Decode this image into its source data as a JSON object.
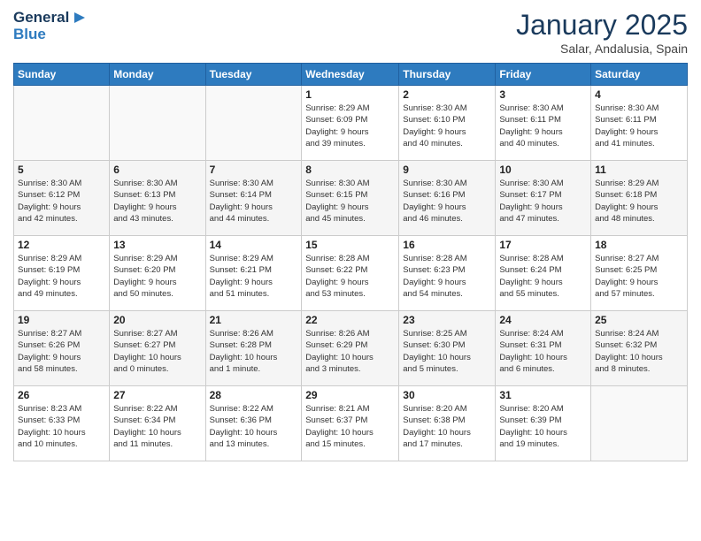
{
  "header": {
    "logo_line1": "General",
    "logo_line2": "Blue",
    "month": "January 2025",
    "location": "Salar, Andalusia, Spain"
  },
  "weekdays": [
    "Sunday",
    "Monday",
    "Tuesday",
    "Wednesday",
    "Thursday",
    "Friday",
    "Saturday"
  ],
  "weeks": [
    [
      {
        "day": "",
        "info": ""
      },
      {
        "day": "",
        "info": ""
      },
      {
        "day": "",
        "info": ""
      },
      {
        "day": "1",
        "info": "Sunrise: 8:29 AM\nSunset: 6:09 PM\nDaylight: 9 hours\nand 39 minutes."
      },
      {
        "day": "2",
        "info": "Sunrise: 8:30 AM\nSunset: 6:10 PM\nDaylight: 9 hours\nand 40 minutes."
      },
      {
        "day": "3",
        "info": "Sunrise: 8:30 AM\nSunset: 6:11 PM\nDaylight: 9 hours\nand 40 minutes."
      },
      {
        "day": "4",
        "info": "Sunrise: 8:30 AM\nSunset: 6:11 PM\nDaylight: 9 hours\nand 41 minutes."
      }
    ],
    [
      {
        "day": "5",
        "info": "Sunrise: 8:30 AM\nSunset: 6:12 PM\nDaylight: 9 hours\nand 42 minutes."
      },
      {
        "day": "6",
        "info": "Sunrise: 8:30 AM\nSunset: 6:13 PM\nDaylight: 9 hours\nand 43 minutes."
      },
      {
        "day": "7",
        "info": "Sunrise: 8:30 AM\nSunset: 6:14 PM\nDaylight: 9 hours\nand 44 minutes."
      },
      {
        "day": "8",
        "info": "Sunrise: 8:30 AM\nSunset: 6:15 PM\nDaylight: 9 hours\nand 45 minutes."
      },
      {
        "day": "9",
        "info": "Sunrise: 8:30 AM\nSunset: 6:16 PM\nDaylight: 9 hours\nand 46 minutes."
      },
      {
        "day": "10",
        "info": "Sunrise: 8:30 AM\nSunset: 6:17 PM\nDaylight: 9 hours\nand 47 minutes."
      },
      {
        "day": "11",
        "info": "Sunrise: 8:29 AM\nSunset: 6:18 PM\nDaylight: 9 hours\nand 48 minutes."
      }
    ],
    [
      {
        "day": "12",
        "info": "Sunrise: 8:29 AM\nSunset: 6:19 PM\nDaylight: 9 hours\nand 49 minutes."
      },
      {
        "day": "13",
        "info": "Sunrise: 8:29 AM\nSunset: 6:20 PM\nDaylight: 9 hours\nand 50 minutes."
      },
      {
        "day": "14",
        "info": "Sunrise: 8:29 AM\nSunset: 6:21 PM\nDaylight: 9 hours\nand 51 minutes."
      },
      {
        "day": "15",
        "info": "Sunrise: 8:28 AM\nSunset: 6:22 PM\nDaylight: 9 hours\nand 53 minutes."
      },
      {
        "day": "16",
        "info": "Sunrise: 8:28 AM\nSunset: 6:23 PM\nDaylight: 9 hours\nand 54 minutes."
      },
      {
        "day": "17",
        "info": "Sunrise: 8:28 AM\nSunset: 6:24 PM\nDaylight: 9 hours\nand 55 minutes."
      },
      {
        "day": "18",
        "info": "Sunrise: 8:27 AM\nSunset: 6:25 PM\nDaylight: 9 hours\nand 57 minutes."
      }
    ],
    [
      {
        "day": "19",
        "info": "Sunrise: 8:27 AM\nSunset: 6:26 PM\nDaylight: 9 hours\nand 58 minutes."
      },
      {
        "day": "20",
        "info": "Sunrise: 8:27 AM\nSunset: 6:27 PM\nDaylight: 10 hours\nand 0 minutes."
      },
      {
        "day": "21",
        "info": "Sunrise: 8:26 AM\nSunset: 6:28 PM\nDaylight: 10 hours\nand 1 minute."
      },
      {
        "day": "22",
        "info": "Sunrise: 8:26 AM\nSunset: 6:29 PM\nDaylight: 10 hours\nand 3 minutes."
      },
      {
        "day": "23",
        "info": "Sunrise: 8:25 AM\nSunset: 6:30 PM\nDaylight: 10 hours\nand 5 minutes."
      },
      {
        "day": "24",
        "info": "Sunrise: 8:24 AM\nSunset: 6:31 PM\nDaylight: 10 hours\nand 6 minutes."
      },
      {
        "day": "25",
        "info": "Sunrise: 8:24 AM\nSunset: 6:32 PM\nDaylight: 10 hours\nand 8 minutes."
      }
    ],
    [
      {
        "day": "26",
        "info": "Sunrise: 8:23 AM\nSunset: 6:33 PM\nDaylight: 10 hours\nand 10 minutes."
      },
      {
        "day": "27",
        "info": "Sunrise: 8:22 AM\nSunset: 6:34 PM\nDaylight: 10 hours\nand 11 minutes."
      },
      {
        "day": "28",
        "info": "Sunrise: 8:22 AM\nSunset: 6:36 PM\nDaylight: 10 hours\nand 13 minutes."
      },
      {
        "day": "29",
        "info": "Sunrise: 8:21 AM\nSunset: 6:37 PM\nDaylight: 10 hours\nand 15 minutes."
      },
      {
        "day": "30",
        "info": "Sunrise: 8:20 AM\nSunset: 6:38 PM\nDaylight: 10 hours\nand 17 minutes."
      },
      {
        "day": "31",
        "info": "Sunrise: 8:20 AM\nSunset: 6:39 PM\nDaylight: 10 hours\nand 19 minutes."
      },
      {
        "day": "",
        "info": ""
      }
    ]
  ]
}
